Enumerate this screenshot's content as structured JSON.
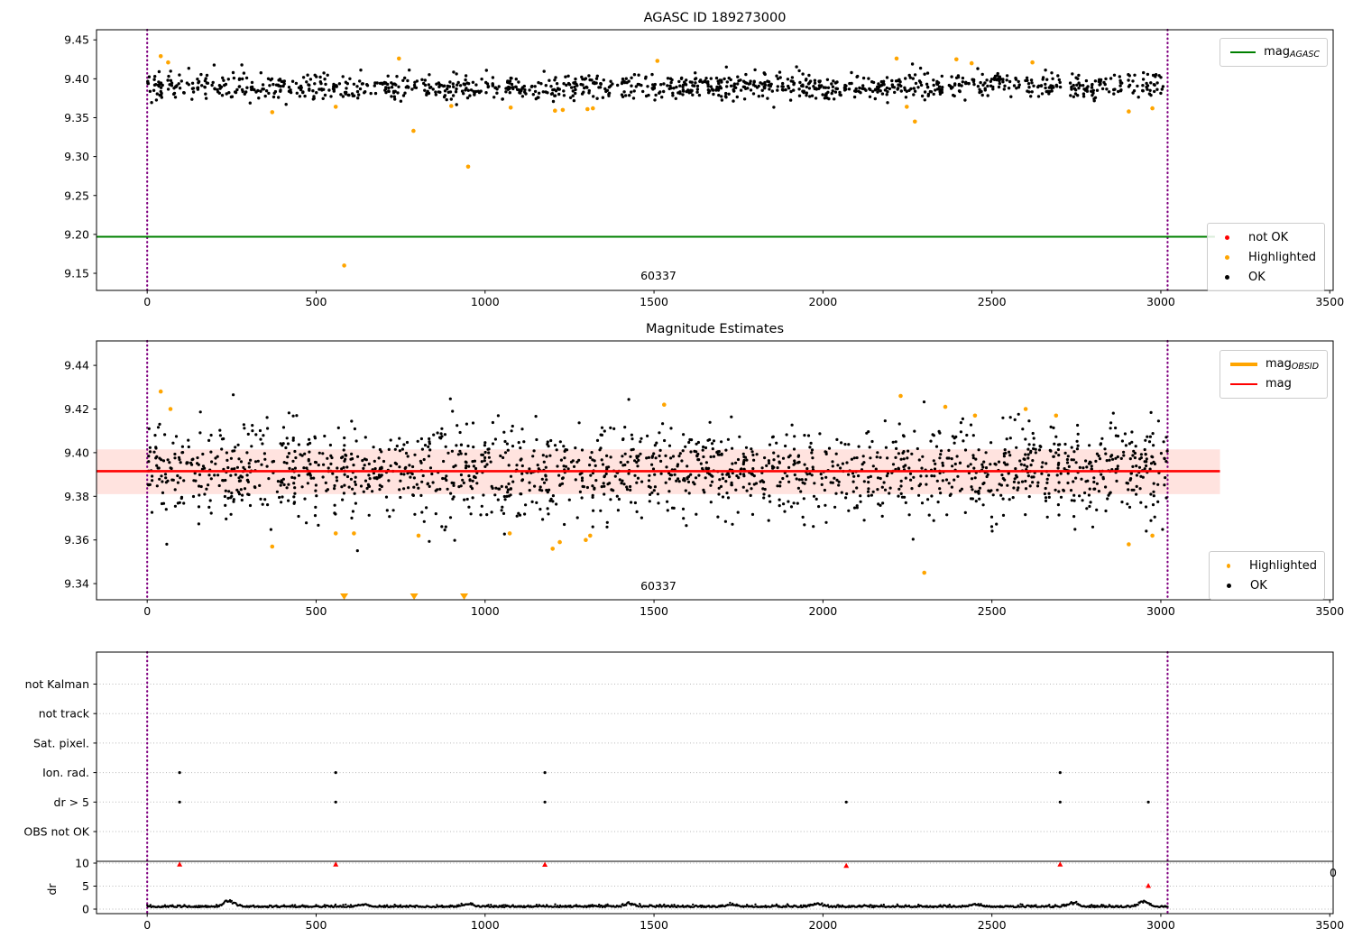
{
  "colors": {
    "ok": "#000000",
    "highlighted": "#ffa500",
    "not_ok": "#ff0000",
    "mag_agasc": "#008000",
    "mag": "#ff0000",
    "mag_obsid": "#ffa500",
    "obsid_vline": "#800080",
    "band_fill": "rgba(255,70,40,0.15)",
    "grid": "#b8b8b8",
    "spine": "#000000"
  },
  "top": {
    "title": "AGASC ID 189273000",
    "obsid": "60337",
    "legend_mag": {
      "label": "mag",
      "sub": "AGASC"
    },
    "legend_status": {
      "items": [
        {
          "label": "not OK"
        },
        {
          "label": "Highlighted"
        },
        {
          "label": "OK"
        }
      ]
    }
  },
  "middle": {
    "title": "Magnitude Estimates",
    "obsid": "60337",
    "legend_mag": {
      "items": [
        {
          "label": "mag",
          "sub": "OBSID"
        },
        {
          "label": "mag",
          "sub": ""
        }
      ]
    },
    "legend_status": {
      "items": [
        {
          "label": "Highlighted"
        },
        {
          "label": "OK"
        }
      ]
    }
  },
  "bottom": {
    "rows": [
      "not Kalman",
      "not track",
      "Sat. pixel.",
      "Ion. rad.",
      "dr > 5",
      "OBS not OK"
    ],
    "dr_ticks": [
      "10",
      "5",
      "0"
    ],
    "ylabel": "dr",
    "right_clipped_label": "0"
  },
  "chart_data": [
    {
      "id": "top",
      "type": "scatter",
      "title": "AGASC ID 189273000",
      "xlim": [
        -150,
        3510
      ],
      "ylim": [
        9.128,
        9.463
      ],
      "xticks": [
        0,
        500,
        1000,
        1500,
        2000,
        2500,
        3000,
        3500
      ],
      "yticks": [
        9.15,
        9.2,
        9.25,
        9.3,
        9.35,
        9.4,
        9.45
      ],
      "obsid_vlines_x": [
        0,
        3020
      ],
      "agasc_mag_line": {
        "y": 9.197,
        "x0": -150,
        "x1": 3160
      },
      "cloud": {
        "n": 1150,
        "x0": 0,
        "x1": 3020,
        "mean": 9.39,
        "sd": 0.0082,
        "clip": [
          9.357,
          9.428
        ],
        "seed": 7
      },
      "highlighted": [
        [
          40,
          9.429
        ],
        [
          62,
          9.421
        ],
        [
          370,
          9.357
        ],
        [
          558,
          9.364
        ],
        [
          583,
          9.16
        ],
        [
          745,
          9.426
        ],
        [
          788,
          9.333
        ],
        [
          900,
          9.365
        ],
        [
          950,
          9.287
        ],
        [
          1076,
          9.363
        ],
        [
          1207,
          9.359
        ],
        [
          1230,
          9.36
        ],
        [
          1303,
          9.361
        ],
        [
          1319,
          9.362
        ],
        [
          1510,
          9.423
        ],
        [
          2218,
          9.426
        ],
        [
          2248,
          9.364
        ],
        [
          2272,
          9.345
        ],
        [
          2395,
          9.425
        ],
        [
          2440,
          9.42
        ],
        [
          2620,
          9.421
        ],
        [
          2905,
          9.358
        ],
        [
          2975,
          9.362
        ]
      ],
      "obsid_text": {
        "label": "60337",
        "x": 1510,
        "y": 9.146
      }
    },
    {
      "id": "middle",
      "type": "scatter",
      "title": "Magnitude Estimates",
      "xlim": [
        -150,
        3510
      ],
      "ylim": [
        9.3326,
        9.4512
      ],
      "xticks": [
        0,
        500,
        1000,
        1500,
        2000,
        2500,
        3000,
        3500
      ],
      "yticks": [
        9.34,
        9.36,
        9.38,
        9.4,
        9.42,
        9.44
      ],
      "obsid_vlines_x": [
        0,
        3020
      ],
      "mag_line": {
        "y": 9.3915,
        "x0": -150,
        "x1": 3175
      },
      "mag_band": {
        "lo": 9.381,
        "hi": 9.4015,
        "x0": -150,
        "x1": 3175
      },
      "cloud": {
        "n": 1700,
        "x0": 0,
        "x1": 3020,
        "mean": 9.3915,
        "sd": 0.0105,
        "clip": [
          9.352,
          9.4295
        ],
        "seed": 11
      },
      "highlighted": [
        [
          40,
          9.428
        ],
        [
          69,
          9.42
        ],
        [
          370,
          9.357
        ],
        [
          558,
          9.363
        ],
        [
          612,
          9.363
        ],
        [
          803,
          9.362
        ],
        [
          1073,
          9.363
        ],
        [
          1200,
          9.356
        ],
        [
          1221,
          9.359
        ],
        [
          1298,
          9.36
        ],
        [
          1311,
          9.362
        ],
        [
          1530,
          9.422
        ],
        [
          2230,
          9.426
        ],
        [
          2300,
          9.345
        ],
        [
          2362,
          9.421
        ],
        [
          2450,
          9.417
        ],
        [
          2600,
          9.42
        ],
        [
          2690,
          9.417
        ],
        [
          2905,
          9.358
        ],
        [
          2975,
          9.362
        ]
      ],
      "clipped_low_x": [
        583,
        790,
        938
      ],
      "obsid_text": {
        "label": "60337",
        "x": 1510,
        "y": 9.3368
      }
    },
    {
      "id": "bottom",
      "type": "flags",
      "xlim": [
        -150,
        3510
      ],
      "xticks": [
        0,
        500,
        1000,
        1500,
        2000,
        2500,
        3000,
        3500
      ],
      "rows": [
        "not Kalman",
        "not track",
        "Sat. pixel.",
        "Ion. rad.",
        "dr > 5",
        "OBS not OK"
      ],
      "flag_events": {
        "Ion. rad.": [
          96,
          558,
          1177,
          2702
        ],
        "dr > 5": [
          96,
          558,
          1177,
          2069,
          2702,
          2963
        ]
      },
      "red_markers": [
        {
          "x": 96,
          "dr": 9.75
        },
        {
          "x": 558,
          "dr": 9.75
        },
        {
          "x": 1177,
          "dr": 9.7
        },
        {
          "x": 2069,
          "dr": 9.45
        },
        {
          "x": 2702,
          "dr": 9.75
        },
        {
          "x": 2963,
          "dr": 5.1
        }
      ],
      "dr_ticks": [
        0,
        5,
        10
      ],
      "separator_dr": 10.4,
      "dr_trace": {
        "x0": 0,
        "x1": 3020,
        "base": 0.4,
        "noise": 0.22,
        "seed": 23,
        "bumps": [
          [
            245,
            1.5
          ],
          [
            640,
            0.6
          ],
          [
            950,
            0.7
          ],
          [
            1430,
            0.7
          ],
          [
            1730,
            0.5
          ],
          [
            1980,
            0.7
          ],
          [
            2450,
            0.6
          ],
          [
            2740,
            0.9
          ],
          [
            2950,
            1.3
          ]
        ]
      },
      "obsid_vlines_x": [
        0,
        3020
      ],
      "ylabel": "dr",
      "right_clipped_label": "0"
    }
  ]
}
